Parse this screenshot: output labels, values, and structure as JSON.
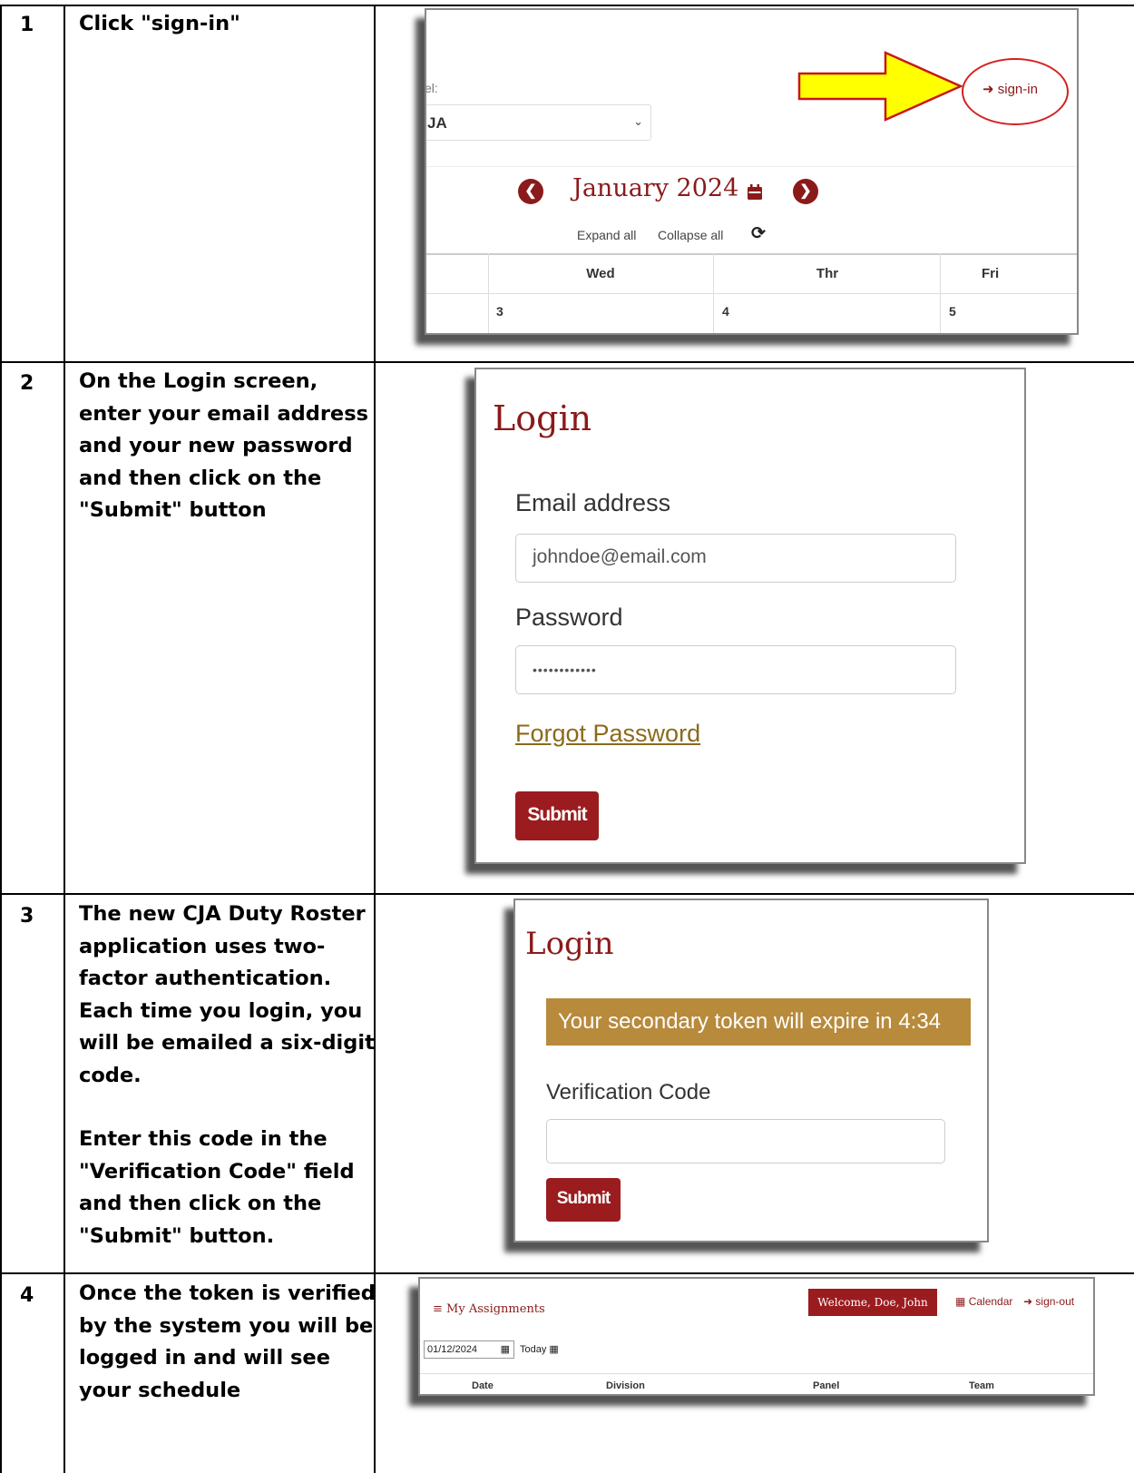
{
  "steps": [
    {
      "number": "1",
      "text": [
        "Click \"sign-in\""
      ],
      "screenshot": {
        "partial_label": "el:",
        "selected_value": "JA",
        "month_title": "January 2024",
        "expand_all": "Expand all",
        "collapse_all": "Collapse all",
        "days": [
          "Wed",
          "Thr",
          "Fri"
        ],
        "dates": [
          "3",
          "4",
          "5"
        ],
        "signin_label": "sign-in",
        "arrow_color": "#ffff00",
        "highlight_color": "#d42020"
      }
    },
    {
      "number": "2",
      "text": [
        "On the Login screen, enter your email address and your new password and then click on the \"Submit\" button"
      ],
      "screenshot": {
        "title": "Login",
        "email_label": "Email address",
        "email_value": "johndoe@email.com",
        "password_label": "Password",
        "password_value": "••••••••••••",
        "forgot_password": "Forgot Password",
        "submit": "Submit"
      }
    },
    {
      "number": "3",
      "text": [
        "The new CJA Duty Roster application uses two-factor authentication. Each time you login, you will be emailed a six-digit code.",
        "Enter this code in the \"Verification Code\" field and then click on the \"Submit\" button."
      ],
      "screenshot": {
        "title": "Login",
        "token_message": "Your secondary token will expire in 4:34",
        "verification_label": "Verification Code",
        "verification_value": "",
        "submit": "Submit",
        "banner_color": "#b88a3c"
      }
    },
    {
      "number": "4",
      "text": [
        "Once the token is verified by the system you will be logged in and will see your schedule"
      ],
      "screenshot": {
        "title": "My Assignments",
        "welcome": "Welcome, Doe, John",
        "calendar_link": "Calendar",
        "signout_link": "sign-out",
        "date_value": "01/12/2024",
        "today_label": "Today",
        "columns": [
          "Date",
          "Division",
          "Panel",
          "Team"
        ]
      }
    }
  ],
  "theme": {
    "brand": "#8b1a1a",
    "button": "#9b1c1f"
  }
}
